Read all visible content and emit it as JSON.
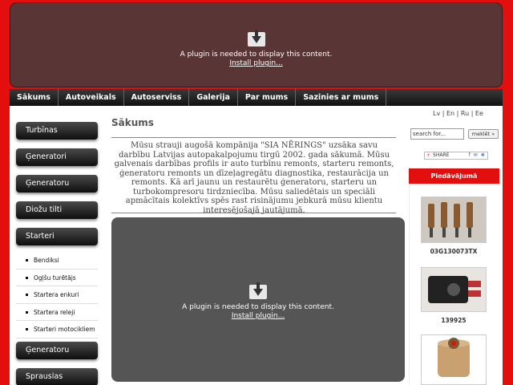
{
  "plugin_top": {
    "message": "A plugin is needed to display this content.",
    "link": "Install plugin..."
  },
  "nav": [
    {
      "label": "Sākums"
    },
    {
      "label": "Autoveikals"
    },
    {
      "label": "Autoserviss"
    },
    {
      "label": "Galerija"
    },
    {
      "label": "Par mums"
    },
    {
      "label": "Sazinies ar mums"
    }
  ],
  "sidebar": {
    "items": [
      "Turbīnas",
      "Ģeneratori",
      "Ģeneratoru",
      "Diožu tilti",
      "Starteri",
      "Ģeneratoru skriemeļi",
      "Sprauslas"
    ],
    "subitems": [
      "Bendiksi",
      "Ogļšu turētājs",
      "Startera enkuri",
      "Startera releji",
      "Starteri motocikliem"
    ]
  },
  "main": {
    "title": "Sākums",
    "intro": "Mūsu strauji augošā kompānija \"SIA NĒRINGS\" uzsāka savu darbību Latvijas autopakalpojumu tirgū 2002. gada sākumā. Mūsu galvenais darbības profils ir auto turbīnu remonts, starteru remonts, ģeneratoru remonts un dīzeļagregātu diagnostika, restaurācija un remonts. Kā arī jaunu un restaurētu ģeneratoru, starteru un turbokompresoru tirdzniecība. Mūsu saliedētais un speciāli apmācītais kolektīvs spēs rast risinājumu jebkurā mūsu klientu interesējošajā jautājumā."
  },
  "plugin_mid": {
    "message": "A plugin is needed to display this content.",
    "link": "Install plugin..."
  },
  "right": {
    "languages": "Lv | En | Ru | Ee",
    "search_placeholder": "search for...",
    "search_button": "meklēt »",
    "share_label": "SHARE",
    "offers_title": "Piedāvājumā",
    "products": [
      {
        "code": "03G130073TX",
        "icon": "injector-set-image"
      },
      {
        "code": "139925",
        "icon": "voltage-regulator-image"
      },
      {
        "code": "",
        "icon": "bearing-image"
      }
    ]
  },
  "colors": {
    "background": "#e30e0e",
    "nav": "#1a1a1a",
    "plugin": "#5a3535"
  }
}
